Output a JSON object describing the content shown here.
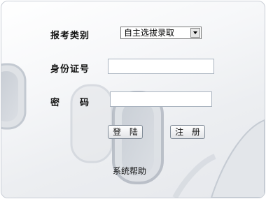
{
  "form": {
    "exam_type_label": "报考类别",
    "exam_type_selected": "自主选拔录取",
    "id_label": "身份证号",
    "id_value": "",
    "password_label": "密　　码",
    "password_value": "",
    "login_button": "登 陆",
    "register_button": "注 册",
    "help_link": "系统帮助"
  },
  "colors": {
    "border": "#c9ced6",
    "background": "#eceef1",
    "button_border": "#7f8a96"
  }
}
